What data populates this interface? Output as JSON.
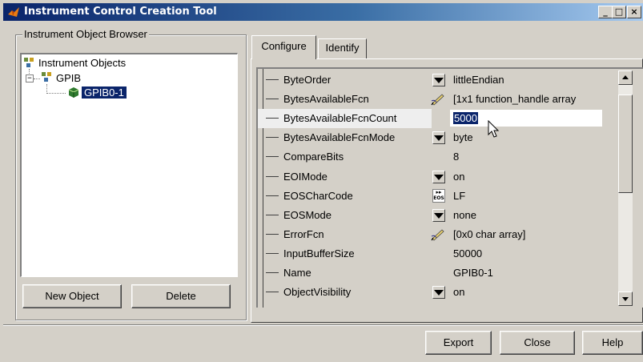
{
  "window": {
    "title": "Instrument Control Creation Tool",
    "controls": {
      "minimize": "_",
      "maximize": "□",
      "close": "×"
    },
    "titlebar_color": "#0a246a"
  },
  "browser": {
    "group_title": "Instrument Object Browser",
    "tree": [
      {
        "label": "Instrument Objects",
        "icon": "instrument-objects-icon"
      },
      {
        "label": "GPIB",
        "icon": "gpib-folder-icon",
        "expander": "−"
      },
      {
        "label": "GPIB0-1",
        "icon": "gpib-object-icon",
        "selected": true
      }
    ],
    "new_object_label": "New Object",
    "delete_label": "Delete"
  },
  "tabs": [
    {
      "label": "Configure",
      "active": true
    },
    {
      "label": "Identify",
      "active": false
    }
  ],
  "properties": [
    {
      "name": "ByteOrder",
      "control": "dropdown",
      "value": "littleEndian"
    },
    {
      "name": "BytesAvailableFcn",
      "control": "edit-callback",
      "value": "[1x1  function_handle array"
    },
    {
      "name": "BytesAvailableFcnCount",
      "control": "none",
      "value": "5000",
      "editing": true
    },
    {
      "name": "BytesAvailableFcnMode",
      "control": "dropdown",
      "value": "byte"
    },
    {
      "name": "CompareBits",
      "control": "none",
      "value": "8"
    },
    {
      "name": "EOIMode",
      "control": "dropdown",
      "value": "on"
    },
    {
      "name": "EOSCharCode",
      "control": "eos",
      "value": "LF"
    },
    {
      "name": "EOSMode",
      "control": "dropdown",
      "value": "none"
    },
    {
      "name": "ErrorFcn",
      "control": "edit-callback",
      "value": "[0x0  char array]"
    },
    {
      "name": "InputBufferSize",
      "control": "none",
      "value": "50000"
    },
    {
      "name": "Name",
      "control": "none",
      "value": "GPIB0-1"
    },
    {
      "name": "ObjectVisibility",
      "control": "dropdown",
      "value": "on"
    }
  ],
  "eos_icon_text": "EOS",
  "footer": {
    "export_label": "Export",
    "close_label": "Close",
    "help_label": "Help"
  },
  "colors": {
    "selection": "#0a246a",
    "face": "#d4d0c8"
  }
}
